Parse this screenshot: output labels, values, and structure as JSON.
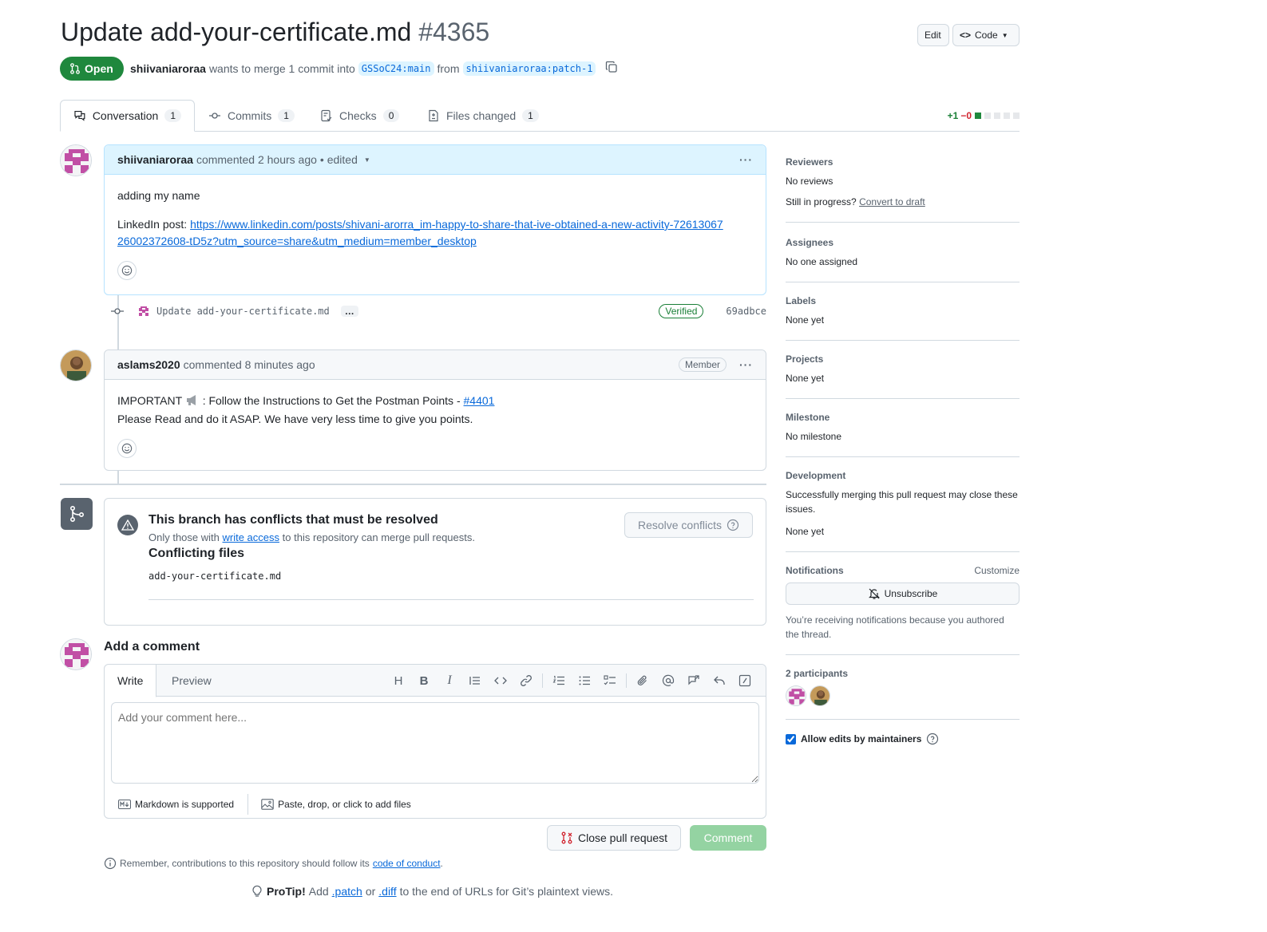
{
  "header": {
    "title": "Update add-your-certificate.md",
    "number": "#4365",
    "edit_label": "Edit",
    "code_label": "Code",
    "state": "Open",
    "author": "shiivaniaroraa",
    "merge_text": "wants to merge 1 commit into",
    "base_branch": "GSSoC24:main",
    "from_text": "from",
    "head_branch": "shiivaniaroraa:patch-1"
  },
  "tabs": [
    {
      "label": "Conversation",
      "count": "1"
    },
    {
      "label": "Commits",
      "count": "1"
    },
    {
      "label": "Checks",
      "count": "0"
    },
    {
      "label": "Files changed",
      "count": "1"
    }
  ],
  "diffstat": {
    "add": "+1",
    "del": "−0"
  },
  "comment1": {
    "author": "shiivaniaroraa",
    "action": "commented 2 hours ago",
    "edited": "• edited",
    "line1": "adding my name",
    "linkedin_prefix": "LinkedIn post:",
    "url": "https://www.linkedin.com/posts/shivani-arorra_im-happy-to-share-that-ive-obtained-a-new-activity-7261306726002372608-tD5z?utm_source=share&utm_medium=member_desktop"
  },
  "commit": {
    "message": "Update add-your-certificate.md",
    "ellipsis": "…",
    "verified": "Verified",
    "sha": "69adbce"
  },
  "comment2": {
    "author": "aslams2020",
    "action": "commented 8 minutes ago",
    "badge": "Member",
    "line1_prefix": "IMPORTANT",
    "line1_text": ": Follow the Instructions to Get the Postman Points -",
    "issue_link": "#4401",
    "line2": "Please Read and do it ASAP. We have very less time to give you points."
  },
  "merge": {
    "title": "This branch has conflicts that must be resolved",
    "sub_prefix": "Only those with",
    "sub_link": "write access",
    "sub_suffix": "to this repository can merge pull requests.",
    "resolve_label": "Resolve conflicts",
    "conflicting_title": "Conflicting files",
    "file": "add-your-certificate.md"
  },
  "compose": {
    "heading": "Add a comment",
    "tab_write": "Write",
    "tab_preview": "Preview",
    "placeholder": "Add your comment here...",
    "markdown_note": "Markdown is supported",
    "files_note": "Paste, drop, or click to add files",
    "close_label": "Close pull request",
    "comment_label": "Comment"
  },
  "footer": {
    "remember_prefix": "Remember, contributions to this repository should follow its",
    "coc_link": "code of conduct",
    "remember_suffix": ".",
    "protip_bold": "ProTip!",
    "protip_add": "Add",
    "patch_link": ".patch",
    "or_text": "or",
    "diff_link": ".diff",
    "protip_suffix": "to the end of URLs for Git’s plaintext views."
  },
  "sidebar": {
    "reviewers_title": "Reviewers",
    "reviewers_value": "No reviews",
    "draft_prefix": "Still in progress?",
    "draft_link": "Convert to draft",
    "assignees_title": "Assignees",
    "assignees_value": "No one assigned",
    "labels_title": "Labels",
    "labels_value": "None yet",
    "projects_title": "Projects",
    "projects_value": "None yet",
    "milestone_title": "Milestone",
    "milestone_value": "No milestone",
    "development_title": "Development",
    "development_text": "Successfully merging this pull request may close these issues.",
    "development_value": "None yet",
    "notifications_title": "Notifications",
    "customize_label": "Customize",
    "unsubscribe_label": "Unsubscribe",
    "notifications_reason": "You’re receiving notifications because you authored the thread.",
    "participants_title": "2 participants",
    "allow_edits_label": "Allow edits by maintainers"
  },
  "colors": {
    "open_green": "#1f883d",
    "link_blue": "#0969da",
    "avatar_pink": "#c14fa5",
    "comment_button_disabled": "#94d3a2"
  }
}
